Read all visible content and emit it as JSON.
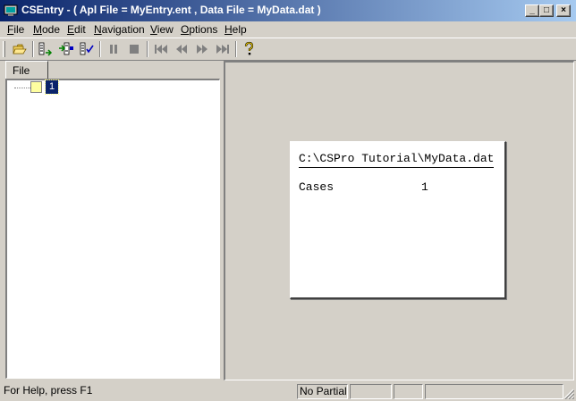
{
  "titlebar": {
    "title": "CSEntry - ( Apl File = MyEntry.ent , Data File = MyData.dat )",
    "minimize_glyph": "_",
    "maximize_glyph": "□",
    "close_glyph": "×"
  },
  "menu": {
    "items": [
      "File",
      "Mode",
      "Edit",
      "Navigation",
      "View",
      "Options",
      "Help"
    ]
  },
  "toolbar": {
    "icons": [
      "open-folder-icon",
      "add-case-icon",
      "insert-case-icon",
      "verify-case-icon",
      "pause-icon",
      "stop-icon",
      "first-case-icon",
      "previous-case-icon",
      "next-case-icon",
      "last-case-icon",
      "help-icon"
    ]
  },
  "case_tree": {
    "tab_label": "File",
    "nodes": [
      {
        "label": "1"
      }
    ]
  },
  "file_summary": {
    "path": "C:\\CSPro Tutorial\\MyData.dat",
    "cases_label": "Cases",
    "cases_value": "1"
  },
  "statusbar": {
    "help_text": "For Help, press F1",
    "partials_text": "No Partials",
    "cell3": "",
    "cell4": "",
    "cell5": ""
  },
  "colors": {
    "title_active": "#0a246a",
    "face": "#d4d0c8",
    "selection": "#0a246a"
  }
}
